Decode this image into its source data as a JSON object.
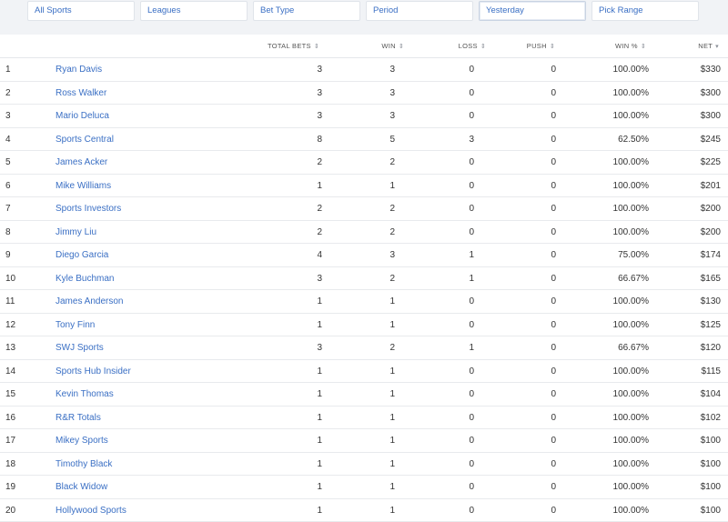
{
  "filters": [
    {
      "label": "All Sports"
    },
    {
      "label": "Leagues"
    },
    {
      "label": "Bet Type"
    },
    {
      "label": "Period"
    },
    {
      "label": "Yesterday"
    },
    {
      "label": "Pick Range"
    }
  ],
  "table": {
    "headers": {
      "total_bets": "TOTAL BETS",
      "win": "WIN",
      "loss": "LOSS",
      "push": "PUSH",
      "win_pct": "WIN %",
      "net": "NET"
    },
    "sort_icon": "⇕",
    "sort_desc_icon": "▾",
    "rows": [
      {
        "rank": "1",
        "name": "Ryan Davis",
        "total": "3",
        "win": "3",
        "loss": "0",
        "push": "0",
        "pct": "100.00%",
        "net": "$330"
      },
      {
        "rank": "2",
        "name": "Ross Walker",
        "total": "3",
        "win": "3",
        "loss": "0",
        "push": "0",
        "pct": "100.00%",
        "net": "$300"
      },
      {
        "rank": "3",
        "name": "Mario Deluca",
        "total": "3",
        "win": "3",
        "loss": "0",
        "push": "0",
        "pct": "100.00%",
        "net": "$300"
      },
      {
        "rank": "4",
        "name": "Sports Central",
        "total": "8",
        "win": "5",
        "loss": "3",
        "push": "0",
        "pct": "62.50%",
        "net": "$245"
      },
      {
        "rank": "5",
        "name": "James Acker",
        "total": "2",
        "win": "2",
        "loss": "0",
        "push": "0",
        "pct": "100.00%",
        "net": "$225"
      },
      {
        "rank": "6",
        "name": "Mike Williams",
        "total": "1",
        "win": "1",
        "loss": "0",
        "push": "0",
        "pct": "100.00%",
        "net": "$201"
      },
      {
        "rank": "7",
        "name": "Sports Investors",
        "total": "2",
        "win": "2",
        "loss": "0",
        "push": "0",
        "pct": "100.00%",
        "net": "$200"
      },
      {
        "rank": "8",
        "name": "Jimmy Liu",
        "total": "2",
        "win": "2",
        "loss": "0",
        "push": "0",
        "pct": "100.00%",
        "net": "$200"
      },
      {
        "rank": "9",
        "name": "Diego Garcia",
        "total": "4",
        "win": "3",
        "loss": "1",
        "push": "0",
        "pct": "75.00%",
        "net": "$174"
      },
      {
        "rank": "10",
        "name": "Kyle Buchman",
        "total": "3",
        "win": "2",
        "loss": "1",
        "push": "0",
        "pct": "66.67%",
        "net": "$165"
      },
      {
        "rank": "11",
        "name": "James Anderson",
        "total": "1",
        "win": "1",
        "loss": "0",
        "push": "0",
        "pct": "100.00%",
        "net": "$130"
      },
      {
        "rank": "12",
        "name": "Tony Finn",
        "total": "1",
        "win": "1",
        "loss": "0",
        "push": "0",
        "pct": "100.00%",
        "net": "$125"
      },
      {
        "rank": "13",
        "name": "SWJ Sports",
        "total": "3",
        "win": "2",
        "loss": "1",
        "push": "0",
        "pct": "66.67%",
        "net": "$120"
      },
      {
        "rank": "14",
        "name": "Sports Hub Insider",
        "total": "1",
        "win": "1",
        "loss": "0",
        "push": "0",
        "pct": "100.00%",
        "net": "$115"
      },
      {
        "rank": "15",
        "name": "Kevin Thomas",
        "total": "1",
        "win": "1",
        "loss": "0",
        "push": "0",
        "pct": "100.00%",
        "net": "$104"
      },
      {
        "rank": "16",
        "name": "R&R Totals",
        "total": "1",
        "win": "1",
        "loss": "0",
        "push": "0",
        "pct": "100.00%",
        "net": "$102"
      },
      {
        "rank": "17",
        "name": "Mikey Sports",
        "total": "1",
        "win": "1",
        "loss": "0",
        "push": "0",
        "pct": "100.00%",
        "net": "$100"
      },
      {
        "rank": "18",
        "name": "Timothy Black",
        "total": "1",
        "win": "1",
        "loss": "0",
        "push": "0",
        "pct": "100.00%",
        "net": "$100"
      },
      {
        "rank": "19",
        "name": "Black Widow",
        "total": "1",
        "win": "1",
        "loss": "0",
        "push": "0",
        "pct": "100.00%",
        "net": "$100"
      },
      {
        "rank": "20",
        "name": "Hollywood Sports",
        "total": "1",
        "win": "1",
        "loss": "0",
        "push": "0",
        "pct": "100.00%",
        "net": "$100"
      }
    ]
  }
}
